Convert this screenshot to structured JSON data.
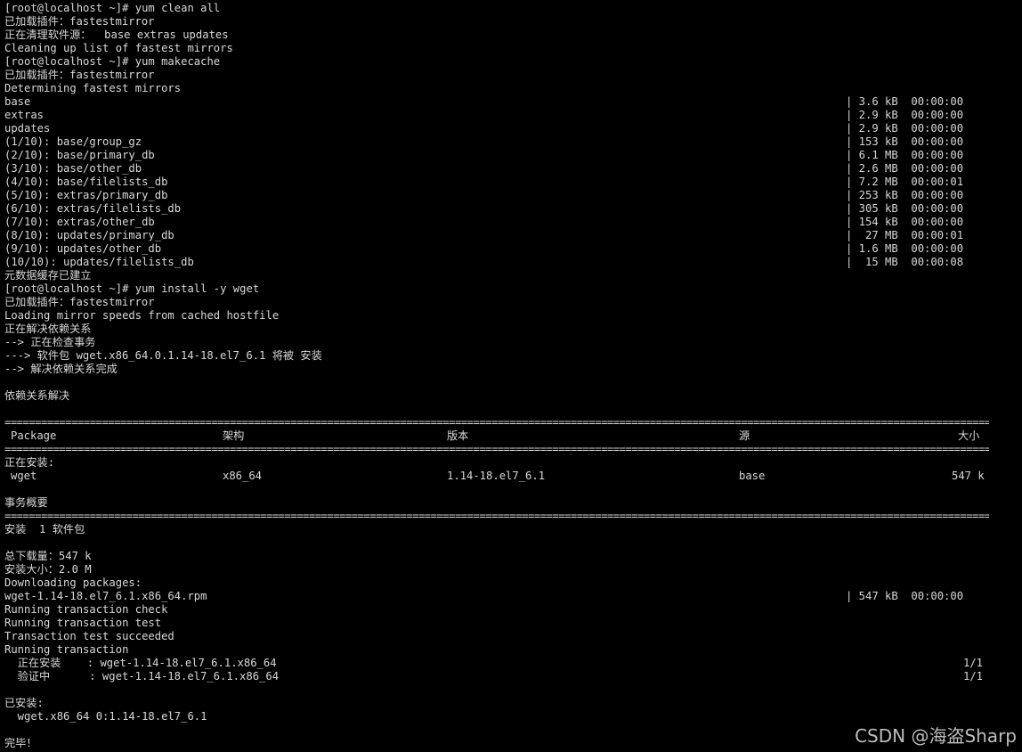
{
  "terminal": {
    "colors": {
      "background": "#000000",
      "foreground": "#d8d8d8"
    },
    "lines": {
      "l01": "[root@localhost ~]# yum clean all",
      "l02": "已加载插件：fastestmirror",
      "l03": "正在清理软件源：  base extras updates",
      "l04": "Cleaning up list of fastest mirrors",
      "l05": "[root@localhost ~]# yum makecache",
      "l06": "已加载插件：fastestmirror",
      "l07": "Determining fastest mirrors",
      "l08": "base",
      "l09": "extras",
      "l10": "updates",
      "l11": "(1/10): base/group_gz",
      "l12": "(2/10): base/primary_db",
      "l13": "(3/10): base/other_db",
      "l14": "(4/10): base/filelists_db",
      "l15": "(5/10): extras/primary_db",
      "l16": "(6/10): extras/filelists_db",
      "l17": "(7/10): extras/other_db",
      "l18": "(8/10): updates/primary_db",
      "l19": "(9/10): updates/other_db",
      "l20": "(10/10): updates/filelists_db",
      "l21": "元数据缓存已建立",
      "l22": "[root@localhost ~]# yum install -y wget",
      "l23": "已加载插件：fastestmirror",
      "l24": "Loading mirror speeds from cached hostfile",
      "l25": "正在解决依赖关系",
      "l26": "--> 正在检查事务",
      "l27": "---> 软件包 wget.x86_64.0.1.14-18.el7_6.1 将被 安装",
      "l28": "--> 解决依赖关系完成",
      "l29": "依赖关系解决",
      "l30": "正在安装:",
      "l31": "事务概要",
      "l32": "安装  1 软件包",
      "l33": "总下载量：547 k",
      "l34": "安装大小：2.0 M",
      "l35": "Downloading packages:",
      "l36": "wget-1.14-18.el7_6.1.x86_64.rpm",
      "l37": "Running transaction check",
      "l38": "Running transaction test",
      "l39": "Transaction test succeeded",
      "l40": "Running transaction",
      "l41": "  正在安装    : wget-1.14-18.el7_6.1.x86_64",
      "l42": "  验证中      : wget-1.14-18.el7_6.1.x86_64",
      "l43": "已安装:",
      "l44": "  wget.x86_64 0:1.14-18.el7_6.1",
      "l45": "完毕！"
    },
    "right": {
      "r08": "| 3.6 kB  00:00:00",
      "r09": "| 2.9 kB  00:00:00",
      "r10": "| 2.9 kB  00:00:00",
      "r11": "| 153 kB  00:00:00",
      "r12": "| 6.1 MB  00:00:00",
      "r13": "| 2.6 MB  00:00:00",
      "r14": "| 7.2 MB  00:00:01",
      "r15": "| 253 kB  00:00:00",
      "r16": "| 305 kB  00:00:00",
      "r17": "| 154 kB  00:00:00",
      "r18": "|  27 MB  00:00:01",
      "r19": "| 1.6 MB  00:00:00",
      "r20": "|  15 MB  00:00:08",
      "r36": "| 547 kB  00:00:00",
      "r41": "1/1",
      "r42": "1/1"
    },
    "table": {
      "separator": "================================================================================================================================================================================",
      "headers": {
        "package": "Package",
        "arch": "架构",
        "version": "版本",
        "repo": "源",
        "size": "大小"
      },
      "row": {
        "package": "wget",
        "arch": "x86_64",
        "version": "1.14-18.el7_6.1",
        "repo": "base",
        "size": "547 k"
      }
    }
  },
  "watermark": "CSDN @海盗Sharp"
}
